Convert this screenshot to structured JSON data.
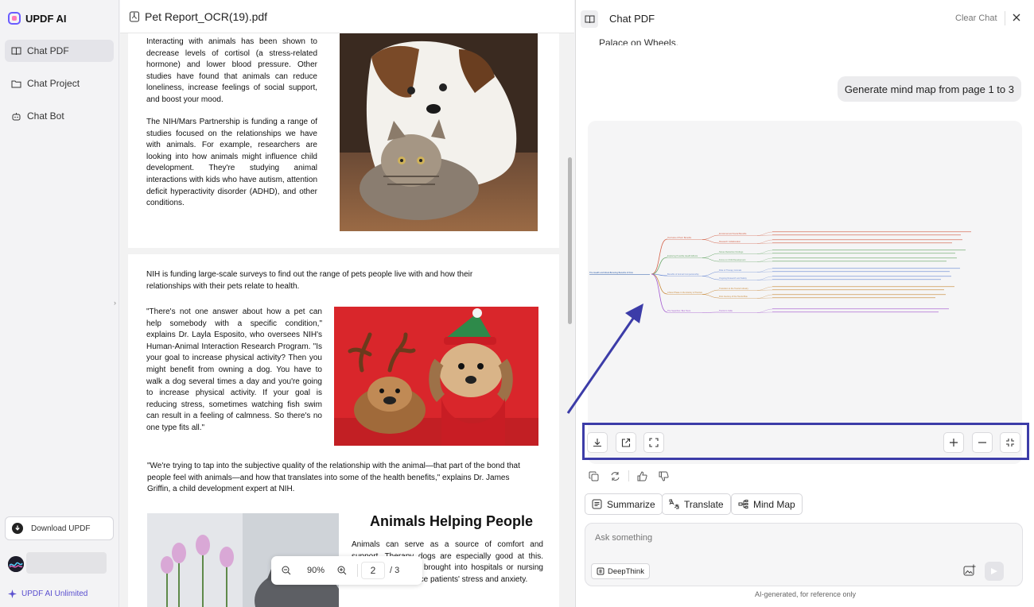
{
  "sidebar": {
    "brand": "UPDF AI",
    "items": [
      {
        "label": "Chat PDF",
        "icon": "book-icon",
        "active": true
      },
      {
        "label": "Chat Project",
        "icon": "folder-icon",
        "active": false
      },
      {
        "label": "Chat Bot",
        "icon": "bot-icon",
        "active": false
      }
    ],
    "download_label": "Download UPDF",
    "unlimited_label": "UPDF AI Unlimited"
  },
  "document": {
    "filename": "Pet Report_OCR(19).pdf",
    "page1": {
      "para1": "Interacting with animals has been shown to decrease levels of cortisol (a stress-related hormone) and lower blood pressure. Other studies have found that animals can reduce loneliness, increase feelings of social support, and boost your mood.",
      "para2": "The NIH/Mars Partnership is funding a range of studies focused on the relationships we have with animals. For example, researchers are looking into how animals might influence child development. They're studying animal interactions with kids who have autism, attention deficit hyperactivity disorder (ADHD), and other conditions."
    },
    "page2": {
      "para1": "NIH is funding large-scale surveys to find out the range of pets people live with and how their relationships with their pets relate to health.",
      "para2": "\"There's not one answer about how a pet can help somebody with a specific condition,\" explains Dr. Layla Esposito, who oversees NIH's Human-Animal Interaction Research Program. \"Is your goal to increase physical activity? Then you might benefit from owning a dog. You have to walk a dog several times a day and you're going to increase physical activity. If your goal is reducing stress, sometimes watching fish swim can result in a feeling of calmness. So there's no one type fits all.\"",
      "para3": "\"We're trying to tap into the subjective quality of the relationship with the animal—that part of the bond that people feel with animals—and how that translates into some of the health benefits,\" explains Dr. James Griffin, a child development expert at NIH.",
      "heading": "Animals Helping People",
      "para4": "Animals can serve as a source of comfort and support. Therapy dogs are especially good at this. They're sometimes brought into hospitals or nursing homes to help reduce patients' stress and anxiety."
    },
    "zoom": "90%",
    "current_page": "2",
    "total_pages": "/ 3"
  },
  "chat": {
    "title": "Chat PDF",
    "clear_label": "Clear Chat",
    "prev_text": "Palace on Wheels.",
    "user_message": "Generate mind map from page 1 to 3",
    "mindmap": {
      "root": "The Health and Mood-Boosting Benefits of Pets",
      "branches": [
        {
          "label": "Overview of Pets' Benefits",
          "children": [
            "Emotional and Social Benefits",
            "Research Collaboration"
          ]
        },
        {
          "label": "Exploring Possible Health Effects",
          "children": [
            "Stress Reduction Findings",
            "Focus on Child Development"
          ]
        },
        {
          "label": "Benefits of Animal Companionship",
          "children": [
            "Role of Therapy Animals",
            "Ongoing Research and Safety"
          ]
        },
        {
          "label": "A New Phase in the History of Tourism",
          "children": [
            "Transition to the Tourist Industry",
            "First Journey of the Tourist Bus"
          ]
        },
        {
          "label": "The Superbus: Bus Tours",
          "children": [
            "Tourist in India"
          ]
        }
      ]
    },
    "chips": {
      "summarize": "Summarize",
      "translate": "Translate",
      "mindmap": "Mind Map"
    },
    "input_placeholder": "Ask something",
    "deepthink_label": "DeepThink",
    "footer_note": "AI-generated, for reference only",
    "colors": {
      "accent": "#5a4fcf",
      "highlight_border": "#3c3ca8",
      "arrow": "#3c3ca8"
    }
  }
}
